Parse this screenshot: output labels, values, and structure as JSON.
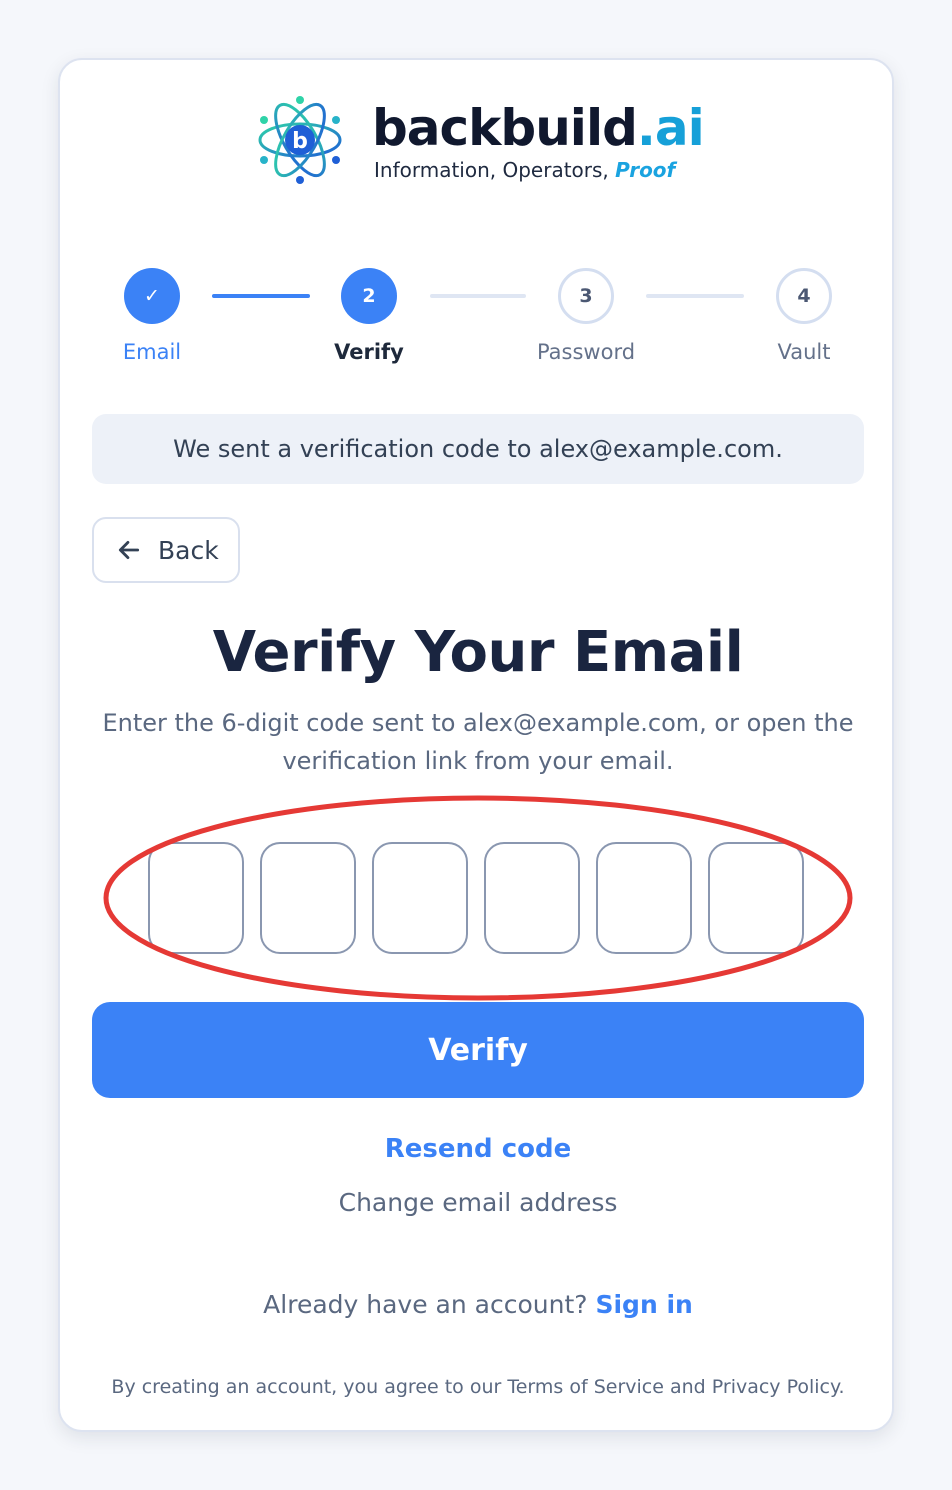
{
  "brand": {
    "name_main": "backbuild",
    "name_suffix": ".ai",
    "tagline_main": "Information, Operators, ",
    "tagline_emphasis": "Proof"
  },
  "stepper": {
    "steps": [
      {
        "label": "Email",
        "marker": "✓",
        "state": "done"
      },
      {
        "label": "Verify",
        "marker": "2",
        "state": "active"
      },
      {
        "label": "Password",
        "marker": "3",
        "state": "todo"
      },
      {
        "label": "Vault",
        "marker": "4",
        "state": "todo"
      }
    ]
  },
  "notice": "We sent a verification code to alex@example.com.",
  "back_label": "Back",
  "title": "Verify Your Email",
  "subtitle": "Enter the 6-digit code sent to alex@example.com, or open the verification link from your email.",
  "otp": {
    "digits": [
      "",
      "",
      "",
      "",
      "",
      ""
    ]
  },
  "verify_label": "Verify",
  "resend_label": "Resend code",
  "change_email_label": "Change email address",
  "signin": {
    "prompt": "Already have an account? ",
    "link": "Sign in"
  },
  "legal": "By creating an account, you agree to our Terms of Service and Privacy Policy.",
  "colors": {
    "accent": "#3b82f6",
    "highlight_ring": "#e53935"
  }
}
